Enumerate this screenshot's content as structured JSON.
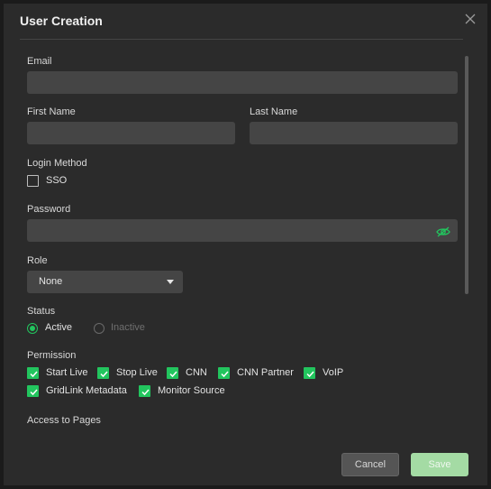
{
  "dialog": {
    "title": "User Creation",
    "close_icon": "close-icon"
  },
  "fields": {
    "email": {
      "label": "Email",
      "value": "",
      "placeholder": ""
    },
    "first_name": {
      "label": "First Name",
      "value": "",
      "placeholder": ""
    },
    "last_name": {
      "label": "Last Name",
      "value": "",
      "placeholder": ""
    },
    "login_method": {
      "label": "Login Method",
      "options": [
        {
          "label": "SSO",
          "checked": false
        }
      ]
    },
    "password": {
      "label": "Password",
      "value": "",
      "placeholder": "",
      "toggle_icon": "eye-icon"
    },
    "role": {
      "label": "Role",
      "selected": "None"
    },
    "status": {
      "label": "Status",
      "options": [
        {
          "label": "Active",
          "selected": true
        },
        {
          "label": "Inactive",
          "selected": false
        }
      ]
    },
    "permission": {
      "label": "Permission",
      "options": [
        {
          "label": "Start Live",
          "checked": true
        },
        {
          "label": "Stop Live",
          "checked": true
        },
        {
          "label": "CNN",
          "checked": true
        },
        {
          "label": "CNN Partner",
          "checked": true
        },
        {
          "label": "VoIP",
          "checked": true
        },
        {
          "label": "GridLink Metadata",
          "checked": true
        },
        {
          "label": "Monitor Source",
          "checked": true
        }
      ]
    },
    "access_to_pages": {
      "label": "Access to Pages"
    }
  },
  "footer": {
    "cancel_label": "Cancel",
    "save_label": "Save"
  },
  "colors": {
    "accent": "#22c55e",
    "save_disabled": "#a4dba4",
    "dialog_bg": "#2b2b2b",
    "input_bg": "#454545"
  }
}
